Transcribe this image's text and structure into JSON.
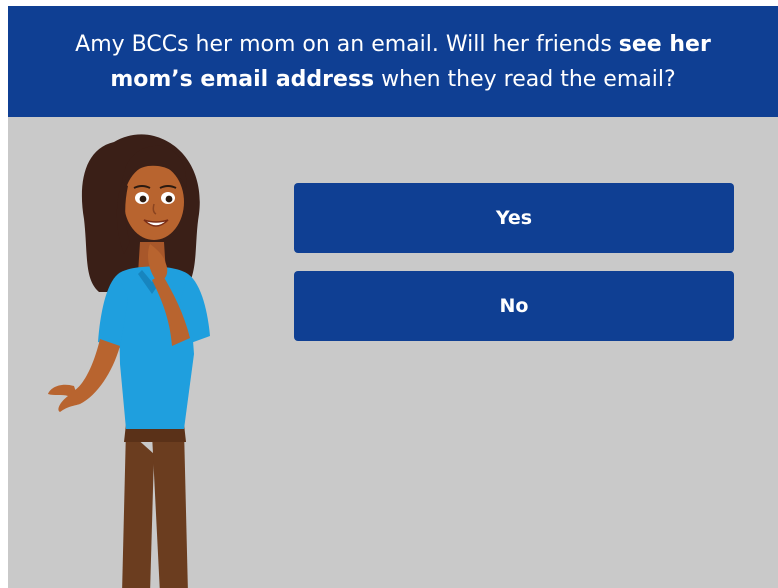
{
  "question": {
    "line1_prefix": "Amy BCCs her mom on an email. Will her friends ",
    "line1_bold": "see her",
    "line2_bold": "mom’s email address",
    "line2_suffix": " when they read the email?"
  },
  "answers": {
    "yes_label": "Yes",
    "no_label": "No"
  },
  "colors": {
    "header_bg": "#0f3f93",
    "button_bg": "#0f3f93",
    "stage_bg": "#c9c9c9",
    "shirt": "#1f9fde",
    "pants": "#6b3d1f",
    "skin": "#b8642f",
    "hair": "#3a1f17"
  }
}
